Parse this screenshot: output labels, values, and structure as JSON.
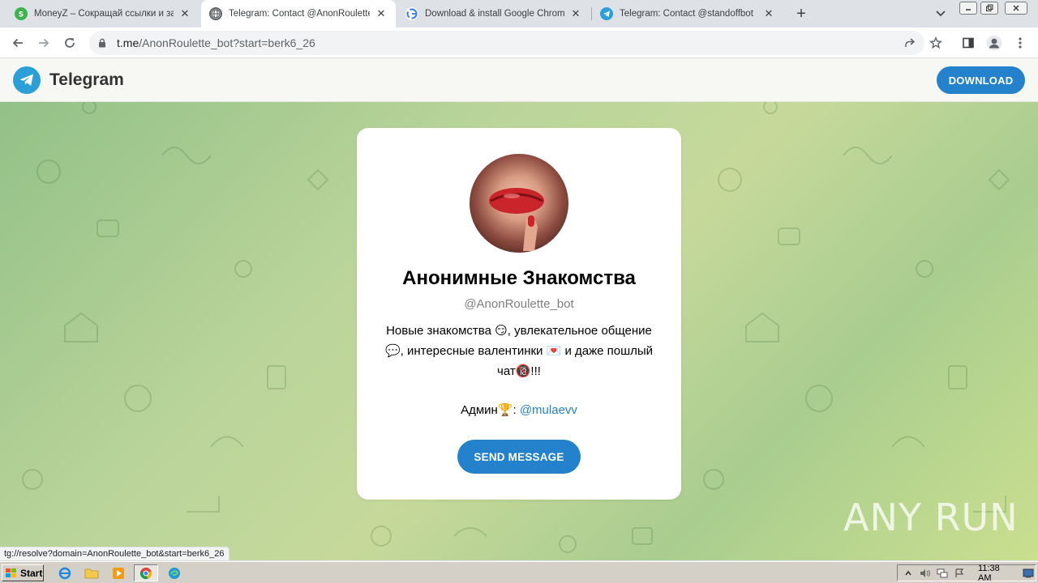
{
  "browser": {
    "tabs": [
      {
        "title": "MoneyZ – Сокращай ссылки и зара",
        "icon": "moneyz-icon",
        "active": false
      },
      {
        "title": "Telegram: Contact @AnonRoulette_b",
        "icon": "globe-icon",
        "active": true
      },
      {
        "title": "Download & install Google Chrome - ",
        "icon": "google-icon",
        "active": false
      },
      {
        "title": "Telegram: Contact @standoffbot",
        "icon": "telegram-icon",
        "active": false
      }
    ],
    "address": {
      "host": "t.me",
      "path": "/AnonRoulette_bot?start=berk6_26"
    },
    "status_url": "tg://resolve?domain=AnonRoulette_bot&start=berk6_26"
  },
  "telegram_page": {
    "brand": "Telegram",
    "download_label": "DOWNLOAD",
    "card": {
      "title": "Анонимные Знакомства",
      "username": "@AnonRoulette_bot",
      "description_line1": "Новые знакомства 😏, увлекательное общение",
      "description_line2": "💬, интересные валентинки 💌 и даже пошлый",
      "description_line3": "чат🔞!!!",
      "admin_label": "Админ🏆: ",
      "admin_link": "@mulaevv",
      "send_label": "SEND MESSAGE"
    }
  },
  "watermark": "ANY RUN",
  "taskbar": {
    "start_label": "Start",
    "clock": "11:38 AM",
    "apps": [
      "ie-icon",
      "folder-icon",
      "media-player-icon",
      "chrome-icon",
      "edge-icon"
    ]
  },
  "colors": {
    "telegram_blue": "#2481cc",
    "logo_blue": "#2a9fd8"
  }
}
